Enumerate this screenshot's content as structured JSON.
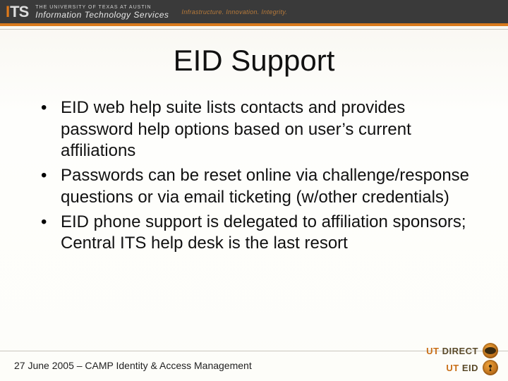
{
  "header": {
    "logo_i": "I",
    "logo_ts": "TS",
    "university": "THE UNIVERSITY OF TEXAS AT AUSTIN",
    "department": "Information Technology Services",
    "tagline": "Infrastructure.  Innovation.  Integrity."
  },
  "title": "EID Support",
  "bullets": [
    "EID web help suite lists contacts and provides password help options based on user’s current affiliations",
    "Passwords can be reset online via challenge/response questions or via email ticketing (w/other credentials)",
    "EID phone support is delegated to affiliation sponsors; Central ITS help desk is the last resort"
  ],
  "footer": "27 June 2005 – CAMP Identity & Access Management",
  "logos": {
    "direct_ut": "UT",
    "direct_label": "DIRECT",
    "eid_ut": "UT",
    "eid_label": "EID"
  }
}
